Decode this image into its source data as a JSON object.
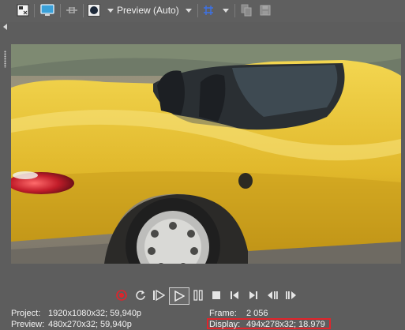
{
  "toolbar": {
    "preview_mode": "Preview (Auto)"
  },
  "status": {
    "project_label": "Project:",
    "project_value": "1920x1080x32; 59,940p",
    "preview_label": "Preview:",
    "preview_value": "480x270x32; 59,940p",
    "frame_label": "Frame:",
    "frame_value": "2 056",
    "display_label": "Display:",
    "display_value": "494x278x32; 18.979"
  },
  "colors": {
    "panel_bg": "#5d5d5d",
    "highlight_border": "#e0242b",
    "record_red": "#e0242b",
    "car_yellow": "#e8c52a"
  },
  "icons": [
    "split-screen-icon",
    "monitor-icon",
    "overlay-icon",
    "quality-icon",
    "grid-icon",
    "copy-snapshot-icon",
    "save-snapshot-icon",
    "record-icon",
    "loop-icon",
    "play-from-start-icon",
    "play-icon",
    "pause-icon",
    "stop-icon",
    "prev-frame-icon",
    "next-frame-icon",
    "go-to-start-icon",
    "go-to-end-icon"
  ]
}
